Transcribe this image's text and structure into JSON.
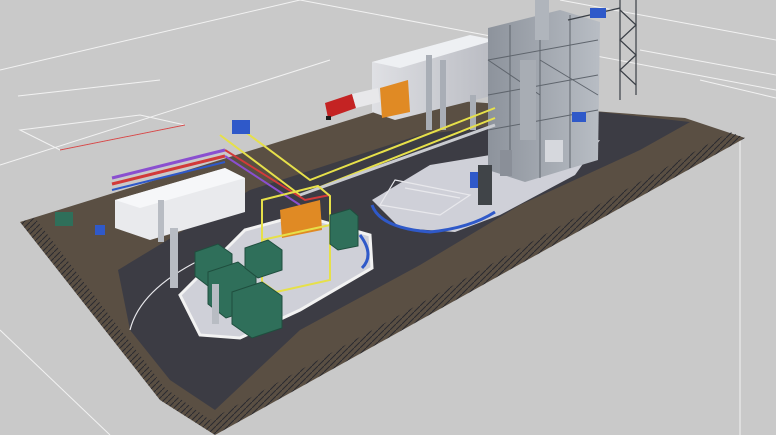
{
  "scene": {
    "kind": "3d-plant-layout-render",
    "colors": {
      "background": "#c9c9c9",
      "ground_grid": "#ffffff",
      "base_slab": "#5a4f43",
      "road": "#3c3c44",
      "paving": "#cfd0d8",
      "tank_green": "#2f6f5a",
      "steel": "#9aa0a8",
      "pipe_yellow": "#e6e04a",
      "pipe_red": "#d23a3a",
      "pipe_purple": "#8a4fd0",
      "pipe_blue": "#2f59c9",
      "fence": "#1f1f24",
      "truck_red": "#c42323",
      "door_orange": "#e08a24"
    }
  }
}
